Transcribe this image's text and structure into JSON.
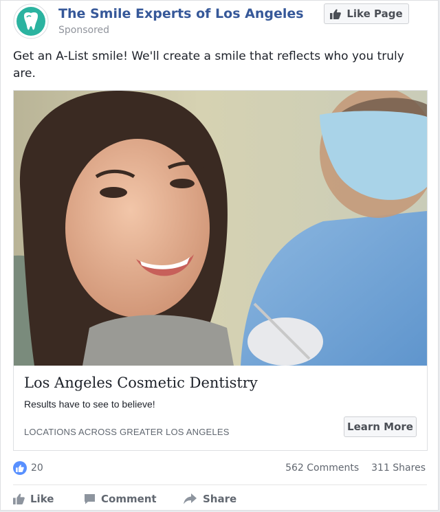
{
  "header": {
    "page_name": "The Smile Experts of Los Angeles",
    "sponsored_label": "Sponsored",
    "like_page_label": "Like Page"
  },
  "post": {
    "caption": "Get an A-List smile! We'll create a smile that reflects who you truly are."
  },
  "ad": {
    "headline": "Los Angeles Cosmetic Dentistry",
    "description": "Results have to see to believe!",
    "domain_text": "LOCATIONS ACROSS GREATER LOS ANGELES",
    "cta_label": "Learn More"
  },
  "engagement": {
    "likes": "20",
    "comments": "562 Comments",
    "shares": "311 Shares"
  },
  "actions": {
    "like": "Like",
    "comment": "Comment",
    "share": "Share"
  },
  "colors": {
    "link_blue": "#365899",
    "like_blue": "#5890ff",
    "logo_teal": "#2bb3a0"
  }
}
